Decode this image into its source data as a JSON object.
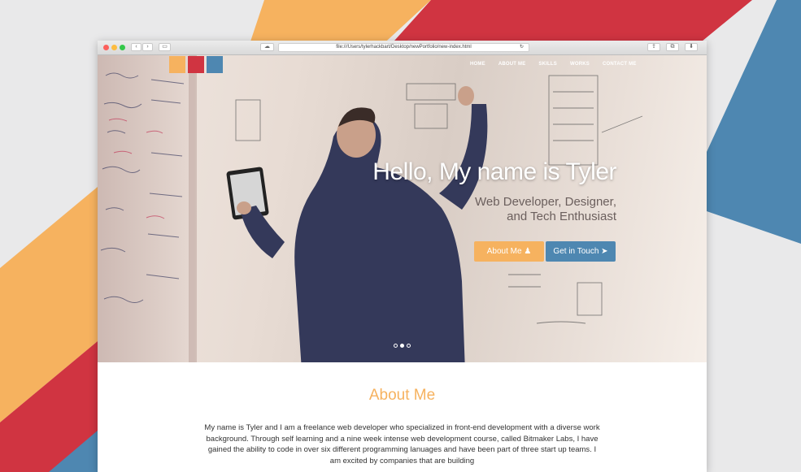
{
  "browser": {
    "url": "file:///Users/tylerhackbart/Desktop/newPortfolio/new-index.html"
  },
  "brand": {
    "colors": {
      "yellow": "#f6b25f",
      "red": "#d03441",
      "blue": "#4e87b1"
    }
  },
  "nav": {
    "items": [
      {
        "label": "HOME"
      },
      {
        "label": "ABOUT ME"
      },
      {
        "label": "SKILLS"
      },
      {
        "label": "WORKS"
      },
      {
        "label": "CONTACT ME"
      }
    ]
  },
  "hero": {
    "headline": "Hello, My name is Tyler",
    "subtitle_line1": "Web Developer, Designer,",
    "subtitle_line2": "and Tech Enthusiast",
    "about_button": "About Me",
    "about_button_icon": "user-icon",
    "contact_button": "Get in Touch",
    "contact_button_icon": "paper-plane-icon",
    "carousel": {
      "slides": 3,
      "active": 2
    }
  },
  "about": {
    "title": "About Me",
    "paragraph": "My name is Tyler and I am a freelance web developer who specialized in front-end development with a diverse work background. Through self learning and a nine week intense web development course, called Bitmaker Labs, I have gained the ability to code in over six different programming lanuages and have been part of three start up teams. I am excited by companies that are building"
  }
}
